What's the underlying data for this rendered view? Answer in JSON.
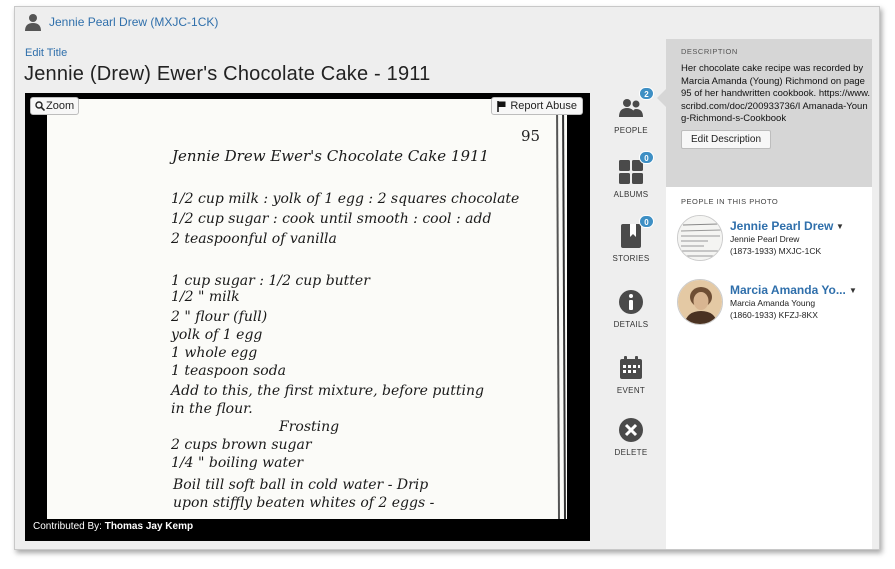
{
  "owner": {
    "name": "Jennie Pearl Drew (MXJC-1CK)"
  },
  "header": {
    "edit_title_label": "Edit Title",
    "title": "Jennie (Drew) Ewer's Chocolate Cake - 1911"
  },
  "viewer": {
    "zoom_label": "Zoom",
    "report_label": "Report Abuse",
    "contributed_prefix": "Contributed By:",
    "contributor": "Thomas Jay Kemp",
    "document": {
      "page_number": "95",
      "lines": [
        "Jennie Drew Ewer's Chocolate Cake 1911",
        "1/2 cup milk : yolk of 1 egg : 2 squares chocolate",
        "1/2 cup sugar : cook until smooth : cool : add",
        "2 teaspoonful of vanilla",
        "1 cup sugar : 1/2 cup butter",
        "1/2 \" milk",
        "2 \" flour (full)",
        "yolk of 1 egg",
        "1 whole egg",
        "1 teaspoon soda",
        "Add to this, the first mixture, before putting",
        "in the flour.",
        "Frosting",
        "2 cups brown sugar",
        "1/4 \" boiling water",
        "Boil till soft ball in cold water - Drip",
        "upon stiffly beaten whites of 2 eggs -"
      ]
    }
  },
  "sidebar": {
    "people": {
      "label": "PEOPLE",
      "count": "2"
    },
    "albums": {
      "label": "ALBUMS",
      "count": "0"
    },
    "stories": {
      "label": "STORIES",
      "count": "0"
    },
    "details": {
      "label": "DETAILS"
    },
    "event": {
      "label": "EVENT"
    },
    "delete": {
      "label": "DELETE"
    }
  },
  "description": {
    "heading": "DESCRIPTION",
    "text": "Her chocolate cake recipe was recorded by Marcia Amanda (Young) Richmond on page 95 of her handwritten cookbook. https://www.scribd.com/doc/200933736/I Amanada-Young-Richmond-s-Cookbook",
    "edit_label": "Edit Description"
  },
  "people_in_photo": {
    "heading": "PEOPLE IN THIS PHOTO",
    "persons": [
      {
        "name": "Jennie Pearl Drew",
        "full_name": "Jennie Pearl Drew",
        "details": "(1873-1933) MXJC-1CK"
      },
      {
        "name": "Marcia Amanda Yo...",
        "full_name": "Marcia Amanda Young",
        "details": "(1860-1933) KFZJ-8KX"
      }
    ]
  },
  "colors": {
    "link": "#2f6fab",
    "badge": "#3e8fc4",
    "icon": "#4a4a4a",
    "panel_bg": "#eeeeee",
    "description_bg": "#d6d6d6"
  }
}
